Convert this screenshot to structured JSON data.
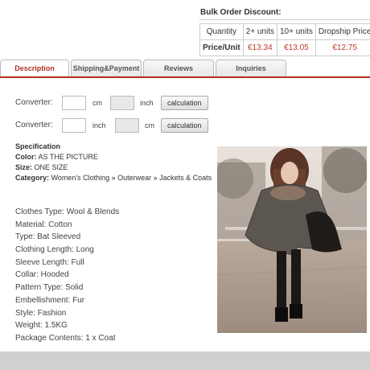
{
  "bulk": {
    "title": "Bulk Order Discount:",
    "headers": [
      "Quantity",
      "2+ units",
      "10+ units",
      "Dropship Price"
    ],
    "row_label": "Price/Unit",
    "prices": [
      "€13.34",
      "€13.05",
      "€12.75"
    ]
  },
  "tabs": [
    {
      "label": "Description"
    },
    {
      "label": "Shipping&Payment"
    },
    {
      "label": "Reviews"
    },
    {
      "label": "Inquiries"
    }
  ],
  "converter": {
    "label": "Converter:",
    "row1": {
      "from_unit": "cm",
      "to_unit": "inch"
    },
    "row2": {
      "from_unit": "inch",
      "to_unit": "cm"
    },
    "button": "calculation"
  },
  "spec": {
    "heading": "Specification",
    "color_label": "Color:",
    "color_value": "AS THE PICTURE",
    "size_label": "Size:",
    "size_value": "ONE SIZE",
    "category_label": "Category:",
    "category_value": "Women's Clothing » Outerwear » Jackets & Coats"
  },
  "details": [
    "Clothes Type: Wool & Blends",
    "Material: Cotton",
    "Type: Bat Sleeved",
    "Clothing Length: Long",
    "Sleeve Length: Full",
    "Collar: Hooded",
    "Pattern Type: Solid",
    "Embellishment: Fur",
    "Style: Fashion",
    "Weight: 1.5KG",
    "Package Contents: 1 x Coat"
  ],
  "colors": {
    "accent": "#b03020",
    "price": "#c0392b"
  },
  "icons": {
    "photo": "product-photo"
  }
}
